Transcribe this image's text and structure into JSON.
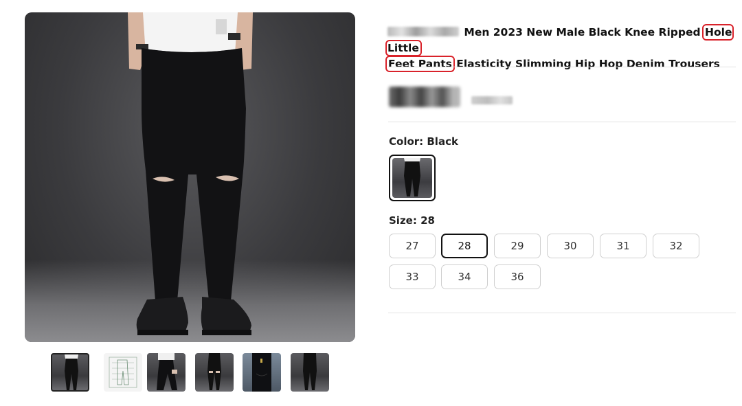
{
  "product": {
    "title_prefix": "Men 2023 New Male Black Knee Ripped",
    "title_highlight_1": "Hole Little",
    "title_highlight_2": "Feet Pants",
    "title_suffix": "Elasticity Slimming Hip Hop Denim Trousers"
  },
  "color": {
    "label": "Color: Black",
    "selected": "Black"
  },
  "size": {
    "label": "Size: 28",
    "selected": "28",
    "options": [
      "27",
      "28",
      "29",
      "30",
      "31",
      "32",
      "33",
      "34",
      "36"
    ]
  },
  "thumbnails": {
    "count": 6,
    "selected_index": 0
  },
  "colors": {
    "highlight_border": "#d9222a",
    "selected_border": "#111111",
    "divider": "#e2e2e2"
  }
}
